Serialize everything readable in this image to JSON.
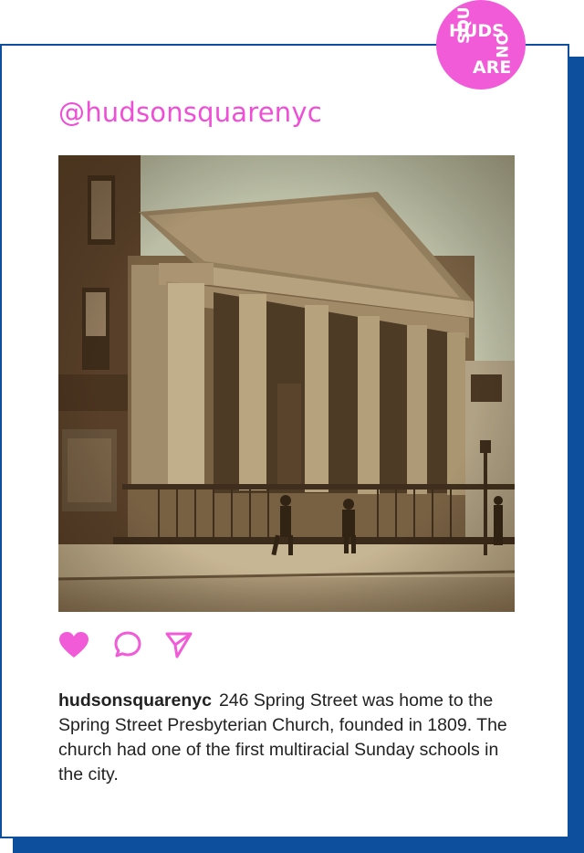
{
  "brand": {
    "logo_text": [
      "HUDS",
      "ON",
      "SQU",
      "ARE"
    ],
    "accent_color": "#f25bd8",
    "frame_color": "#0d4f9c"
  },
  "post": {
    "handle": "@hudsonsquarenyc",
    "image_icon": "historic-church-photo",
    "actions": [
      {
        "name": "like",
        "icon": "heart-icon",
        "filled": true
      },
      {
        "name": "comment",
        "icon": "speech-bubble-icon",
        "filled": false
      },
      {
        "name": "share",
        "icon": "send-icon",
        "filled": false
      }
    ],
    "caption": {
      "username": "hudsonsquarenyc",
      "text": "246 Spring Street was home to the Spring Street Presbyterian Church, founded in 1809. The church had one of the first multiracial Sunday schools in the city."
    }
  }
}
